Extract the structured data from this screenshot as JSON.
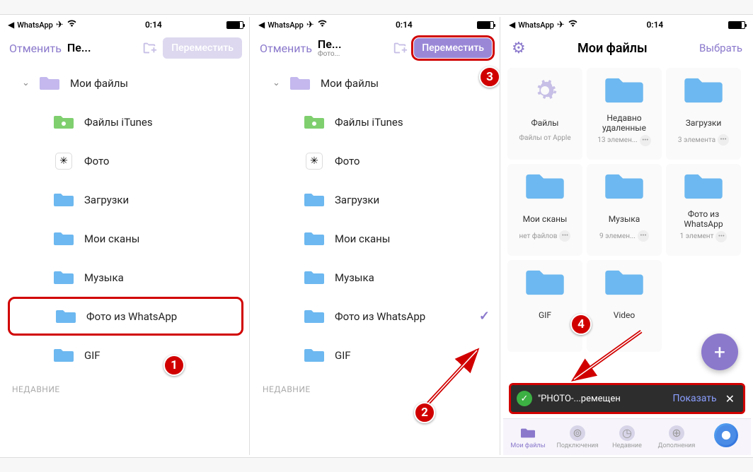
{
  "status": {
    "back_app": "WhatsApp",
    "time": "0:14"
  },
  "nav": {
    "cancel": "Отменить",
    "title_short": "Пе...",
    "subtitle": "Фото...",
    "move": "Переместить"
  },
  "folders": {
    "root": "Мои файлы",
    "items": [
      {
        "label": "Файлы iTunes",
        "type": "itunes"
      },
      {
        "label": "Фото",
        "type": "photos"
      },
      {
        "label": "Загрузки",
        "type": "folder"
      },
      {
        "label": "Мои сканы",
        "type": "folder"
      },
      {
        "label": "Музыка",
        "type": "folder"
      },
      {
        "label": "Фото из  WhatsApp",
        "type": "folder"
      },
      {
        "label": "GIF",
        "type": "folder"
      }
    ],
    "recent_header": "НЕДАВНИЕ"
  },
  "grid_screen": {
    "title": "Мои файлы",
    "select": "Выбрать",
    "tiles": [
      {
        "name": "Файлы",
        "meta": "Файлы от Apple",
        "icon": "gear"
      },
      {
        "name": "Недавно удаленные",
        "meta": "13 элемен...",
        "icon": "folder"
      },
      {
        "name": "Загрузки",
        "meta": "3 элемента",
        "icon": "folder"
      },
      {
        "name": "Мои сканы",
        "meta": "нет файлов",
        "icon": "folder"
      },
      {
        "name": "Музыка",
        "meta": "9 элемен...",
        "icon": "folder"
      },
      {
        "name": "Фото из WhatsApp",
        "meta": "1 элемент",
        "icon": "folder"
      },
      {
        "name": "GIF",
        "meta": "",
        "icon": "folder"
      },
      {
        "name": "Video",
        "meta": "",
        "icon": "folder"
      }
    ]
  },
  "toast": {
    "msg": "\"PHOTO-...ремещен",
    "show": "Показать"
  },
  "tabs": {
    "items": [
      "Мои файлы",
      "Подключения",
      "Недавние",
      "Дополнения"
    ]
  },
  "badges": [
    "1",
    "2",
    "3",
    "4"
  ]
}
